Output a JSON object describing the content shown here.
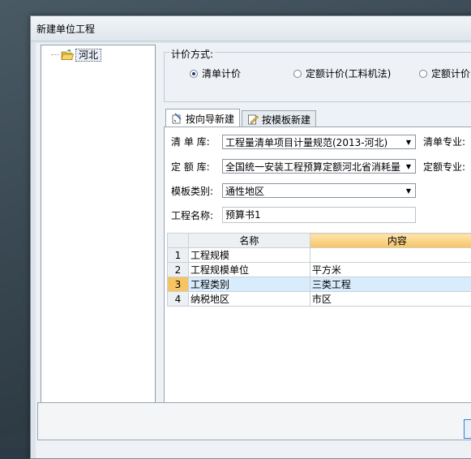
{
  "window": {
    "title": "新建单位工程"
  },
  "tree": {
    "root_label": "河北"
  },
  "pricing": {
    "label": "计价方式:",
    "options": [
      "清单计价",
      "定额计价(工料机法)",
      "定额计价"
    ],
    "selected": "清单计价"
  },
  "tabs": [
    {
      "label": "按向导新建",
      "active": true
    },
    {
      "label": "按模板新建",
      "active": false
    }
  ],
  "form": {
    "list_lib_label": "清 单 库:",
    "list_lib_value": "工程量清单项目计量规范(2013-河北)",
    "list_major_label": "清单专业:",
    "quota_lib_label": "定 额 库:",
    "quota_lib_value": "全国统一安装工程预算定额河北省消耗量",
    "quota_major_label": "定额专业:",
    "template_label": "模板类别:",
    "template_value": "通性地区",
    "name_label": "工程名称:",
    "name_value": "预算书1"
  },
  "grid": {
    "headers": [
      "名称",
      "内容"
    ],
    "rows": [
      {
        "no": "1",
        "name": "工程规模",
        "value": ""
      },
      {
        "no": "2",
        "name": "工程规模单位",
        "value": "平方米"
      },
      {
        "no": "3",
        "name": "工程类别",
        "value": "三类工程"
      },
      {
        "no": "4",
        "name": "纳税地区",
        "value": "市区"
      }
    ],
    "selected_row": 3
  },
  "colors": {
    "accent": "#f6c462",
    "selection": "#d9ecfb",
    "border": "#9aa6b0"
  }
}
